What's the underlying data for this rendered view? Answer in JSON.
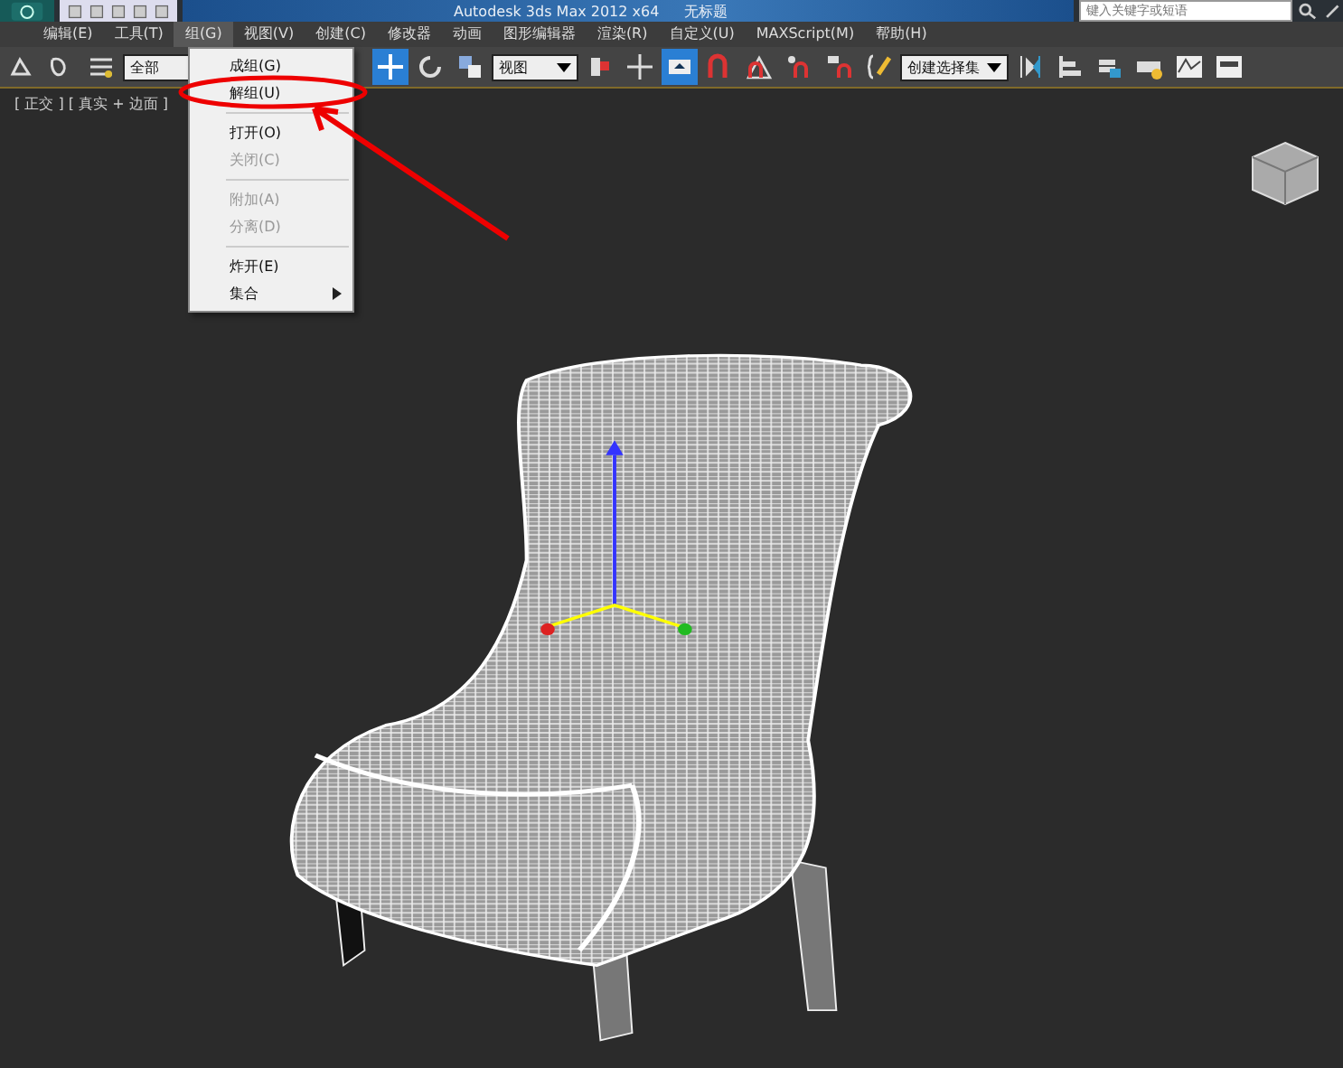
{
  "window": {
    "title": "Autodesk 3ds Max  2012 x64",
    "document": "无标题",
    "search": {
      "placeholder": "键入关键字或短语"
    }
  },
  "menu_bar": [
    {
      "label": "编辑(E)",
      "selected": false
    },
    {
      "label": "工具(T)",
      "selected": false
    },
    {
      "label": "组(G)",
      "selected": true
    },
    {
      "label": "视图(V)",
      "selected": false
    },
    {
      "label": "创建(C)",
      "selected": false
    },
    {
      "label": "修改器",
      "selected": false
    },
    {
      "label": "动画",
      "selected": false
    },
    {
      "label": "图形编辑器",
      "selected": false
    },
    {
      "label": "渲染(R)",
      "selected": false
    },
    {
      "label": "自定义(U)",
      "selected": false
    },
    {
      "label": "MAXScript(M)",
      "selected": false
    },
    {
      "label": "帮助(H)",
      "selected": false
    }
  ],
  "toolbar": [
    {
      "kind": "tool",
      "selected": false
    },
    {
      "kind": "tool",
      "selected": false
    },
    {
      "kind": "tool",
      "selected": false
    },
    {
      "kind": "dropdown",
      "value": "全部"
    },
    {
      "kind": "gap"
    },
    {
      "kind": "tool",
      "selected": true
    },
    {
      "kind": "tool",
      "selected": false
    },
    {
      "kind": "tool",
      "selected": false
    },
    {
      "kind": "dropdown",
      "value": "视图"
    },
    {
      "kind": "tool",
      "selected": false
    },
    {
      "kind": "tool",
      "selected": false
    },
    {
      "kind": "tool",
      "selected": true
    },
    {
      "kind": "tool",
      "selected": false
    },
    {
      "kind": "tool",
      "selected": false
    },
    {
      "kind": "tool",
      "selected": false
    },
    {
      "kind": "tool",
      "selected": false
    },
    {
      "kind": "tool",
      "selected": false
    },
    {
      "kind": "dropdown",
      "value": "创建选择集"
    },
    {
      "kind": "tool",
      "selected": false
    },
    {
      "kind": "tool",
      "selected": false
    },
    {
      "kind": "tool",
      "selected": false
    },
    {
      "kind": "tool",
      "selected": false
    },
    {
      "kind": "tool",
      "selected": false
    },
    {
      "kind": "tool",
      "selected": false
    }
  ],
  "group_menu": [
    {
      "kind": "item",
      "label": "成组(G)",
      "disabled": false,
      "submenu": false
    },
    {
      "kind": "item",
      "label": "解组(U)",
      "disabled": false,
      "submenu": false
    },
    {
      "kind": "separator"
    },
    {
      "kind": "item",
      "label": "打开(O)",
      "disabled": false,
      "submenu": false
    },
    {
      "kind": "item",
      "label": "关闭(C)",
      "disabled": true,
      "submenu": false
    },
    {
      "kind": "separator"
    },
    {
      "kind": "item",
      "label": "附加(A)",
      "disabled": true,
      "submenu": false
    },
    {
      "kind": "item",
      "label": "分离(D)",
      "disabled": true,
      "submenu": false
    },
    {
      "kind": "separator"
    },
    {
      "kind": "item",
      "label": "炸开(E)",
      "disabled": false,
      "submenu": false
    },
    {
      "kind": "item",
      "label": "集合",
      "disabled": false,
      "submenu": true
    }
  ],
  "viewport": {
    "label": "[ 正交 ] [ 真实 + 边面 ]"
  }
}
